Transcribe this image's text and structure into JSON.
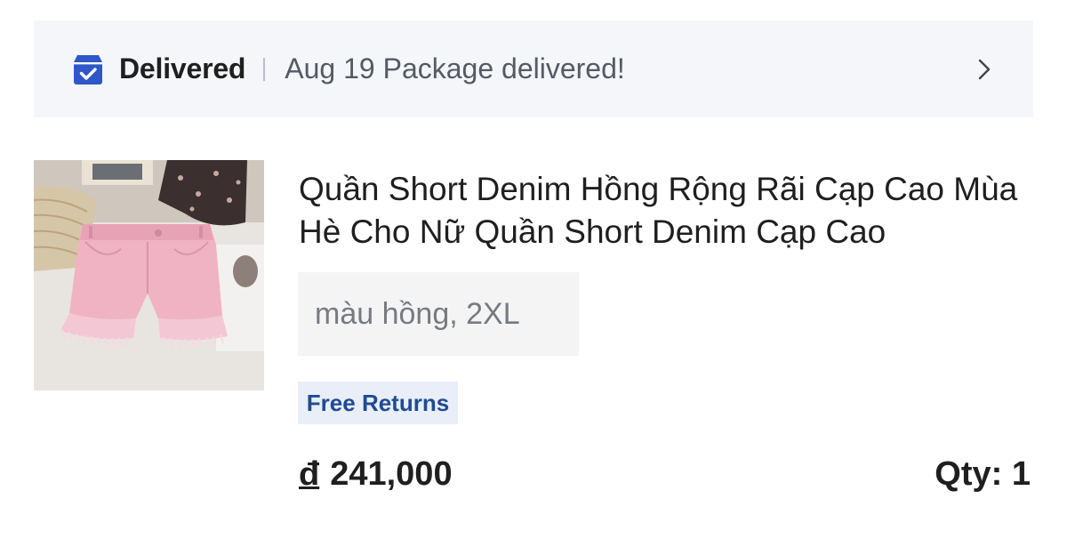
{
  "delivery": {
    "status": "Delivered",
    "message": "Aug 19 Package delivered!",
    "icon": "package-check-icon",
    "accent_color": "#2f57c8"
  },
  "product": {
    "image_description": "pink denim shorts product photo",
    "title": "Quần Short Denim Hồng Rộng Rãi Cạp Cao Mùa Hè Cho Nữ Quần Short Denim Cạp Cao",
    "variant": "màu hồng, 2XL",
    "badge": "Free Returns",
    "currency": "đ",
    "price": "241,000",
    "quantity": "Qty: 1"
  }
}
